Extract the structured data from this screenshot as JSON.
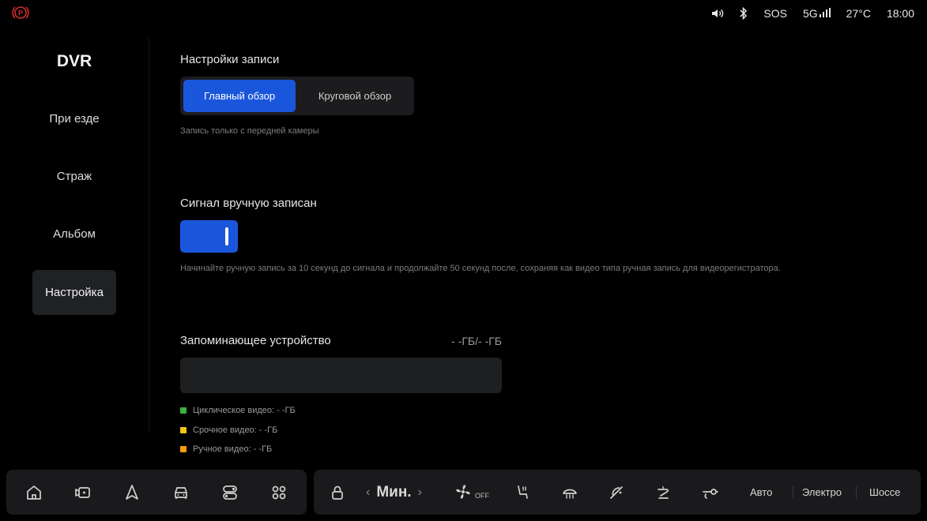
{
  "status_bar": {
    "sos_label": "SOS",
    "network_label": "5G",
    "temperature": "27°C",
    "time": "18:00",
    "icons": [
      "parking-brake-icon",
      "volume-icon",
      "bluetooth-icon",
      "signal-bars-icon"
    ],
    "alert_color": "#d32f2f"
  },
  "sidebar": {
    "title": "DVR",
    "items": [
      {
        "label": "При езде",
        "active": false
      },
      {
        "label": "Страж",
        "active": false
      },
      {
        "label": "Альбом",
        "active": false
      },
      {
        "label": "Настройка",
        "active": true
      }
    ]
  },
  "recording": {
    "title": "Настройки записи",
    "options": [
      "Главный обзор",
      "Круговой обзор"
    ],
    "selected": "Главный обзор",
    "hint": "Запись только с передней камеры"
  },
  "manual_signal": {
    "title": "Сигнал вручную записан",
    "enabled": true,
    "hint": "Начинайте ручную запись за 10 секунд до сигнала и продолжайте 50 секунд после, сохраняя как видео типа ручная запись для видеорегистратора."
  },
  "storage": {
    "title": "Запоминающее устройство",
    "value": "- -ГБ/- -ГБ",
    "legend": [
      {
        "label": "Циклическое видео: - -ГБ",
        "color": "#3cb043"
      },
      {
        "label": "Срочное видео: - -ГБ",
        "color": "#f5c518"
      },
      {
        "label": "Ручное видео: - -ГБ",
        "color": "#f59e0b"
      }
    ]
  },
  "dock": {
    "left_icons": [
      "home-icon",
      "dvr-camera-icon",
      "navigation-icon",
      "car-icon",
      "toggle-switches-icon",
      "apps-grid-icon"
    ],
    "fan_speed": "Мин.",
    "fan_state": "OFF",
    "modes": [
      "Авто",
      "Электро",
      "Шоссе"
    ]
  },
  "accent_color": "#1a56db"
}
